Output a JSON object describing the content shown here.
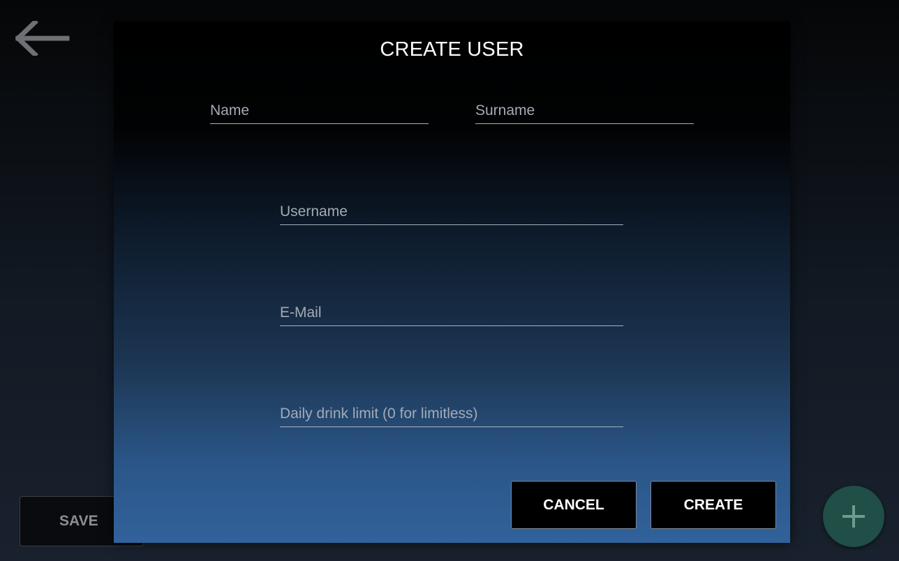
{
  "background": {
    "save_label": "SAVE",
    "back_icon": "arrow-left-icon",
    "add_icon": "plus-icon"
  },
  "dialog": {
    "title": "CREATE USER",
    "fields": {
      "name": {
        "placeholder": "Name",
        "value": ""
      },
      "surname": {
        "placeholder": "Surname",
        "value": ""
      },
      "username": {
        "placeholder": "Username",
        "value": ""
      },
      "email": {
        "placeholder": "E-Mail",
        "value": ""
      },
      "drink_limit": {
        "placeholder": "Daily drink limit (0 for limitless)",
        "value": ""
      }
    },
    "cancel_label": "CANCEL",
    "create_label": "CREATE"
  },
  "colors": {
    "fab_background": "#1f4f46",
    "dialog_gradient_bottom": "#31629b",
    "field_underline": "#a9b1bb"
  }
}
